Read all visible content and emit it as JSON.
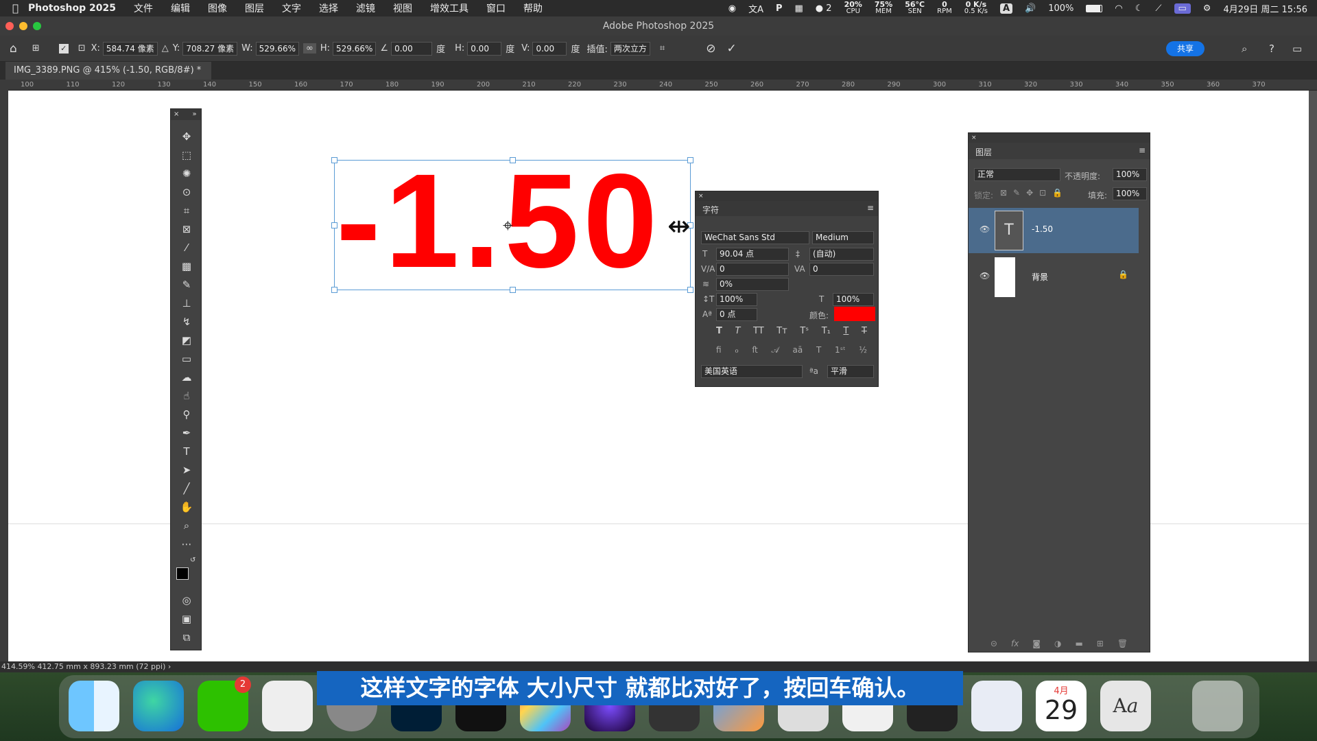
{
  "menubar": {
    "app": "Photoshop 2025",
    "items": [
      "文件",
      "编辑",
      "图像",
      "图层",
      "文字",
      "选择",
      "滤镜",
      "视图",
      "增效工具",
      "窗口",
      "帮助"
    ],
    "wechat_count": "2",
    "cpu": "20%",
    "cpu_label": "CPU",
    "mem": "75%",
    "mem_label": "MEM",
    "temp": "56°C",
    "temp_label": "SEN",
    "rpm": "0",
    "rpm_label": "RPM",
    "net_up": "0 K/s",
    "net_down": "0.5 K/s",
    "input": "A",
    "battery": "100%",
    "datetime": "4月29日 周二 15:56"
  },
  "window": {
    "title": "Adobe Photoshop 2025"
  },
  "options": {
    "x_label": "X:",
    "x": "584.74 像素",
    "y_label": "Y:",
    "y": "708.27 像素",
    "w_label": "W:",
    "w": "529.66%",
    "h_label": "H:",
    "h": "529.66%",
    "angle": "0.00",
    "angle_unit": "度",
    "hskew_label": "H:",
    "hskew": "0.00",
    "hskew_unit": "度",
    "vskew_label": "V:",
    "vskew": "0.00",
    "vskew_unit": "度",
    "interp_label": "插值:",
    "interp": "两次立方",
    "share": "共享"
  },
  "doc": {
    "tab": "IMG_3389.PNG @ 415% (-1.50, RGB/8#) *"
  },
  "ruler": [
    "100",
    "110",
    "120",
    "130",
    "140",
    "150",
    "160",
    "170",
    "180",
    "190",
    "200",
    "210",
    "220",
    "230",
    "240",
    "250",
    "260",
    "270",
    "280",
    "290",
    "300",
    "310",
    "320",
    "330",
    "340",
    "350",
    "360",
    "370"
  ],
  "canvas": {
    "text": "-1.50",
    "text_color": "#ff0000"
  },
  "character_panel": {
    "title": "字符",
    "font_family": "WeChat Sans Std",
    "font_style": "Medium",
    "size": "90.04 点",
    "leading": "(自动)",
    "kerning": "0",
    "tracking": "0",
    "tsume": "0%",
    "vscale": "100%",
    "hscale": "100%",
    "baseline": "0 点",
    "color_label": "颜色:",
    "color": "#ff0000",
    "language": "美国英语",
    "aa_label": "a",
    "antialias": "平滑"
  },
  "layers_panel": {
    "title": "图层",
    "blend": "正常",
    "opacity_label": "不透明度:",
    "opacity": "100%",
    "lock_label": "锁定:",
    "fill_label": "填充:",
    "fill": "100%",
    "layers": [
      {
        "name": "-1.50",
        "thumb": "T",
        "selected": true
      },
      {
        "name": "背景",
        "thumb": "",
        "selected": false
      }
    ]
  },
  "status": {
    "text": "414.59%   412.75 mm x 893.23 mm (72 ppi)  ›"
  },
  "subtitle": "这样文字的字体 大小尺寸  就都比对好了，按回车确认。",
  "dock": {
    "calendar_month": "4月",
    "calendar_day": "29",
    "badge": "2"
  }
}
